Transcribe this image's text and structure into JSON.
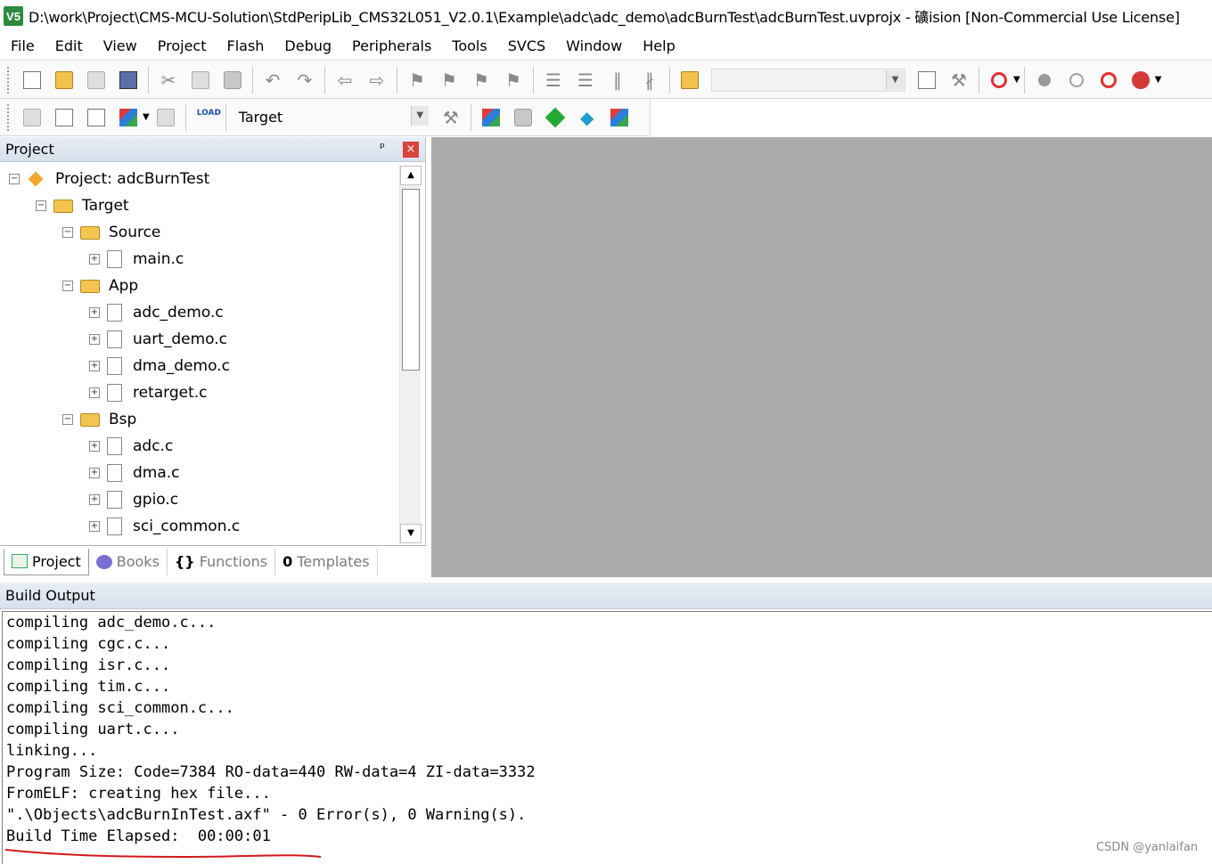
{
  "window": {
    "title": "D:\\work\\Project\\CMS-MCU-Solution\\StdPeripLib_CMS32L051_V2.0.1\\Example\\adc\\adc_demo\\adcBurnTest\\adcBurnTest.uvprojx - 礦ision  [Non-Commercial Use License]",
    "app_icon_label": "V5"
  },
  "menu": [
    "File",
    "Edit",
    "View",
    "Project",
    "Flash",
    "Debug",
    "Peripherals",
    "Tools",
    "SVCS",
    "Window",
    "Help"
  ],
  "toolbar2": {
    "load_label": "LOAD",
    "target_value": "Target"
  },
  "project_panel": {
    "header": "Project",
    "pin_glyph": "ᵖ",
    "close_glyph": "×",
    "tree": {
      "project": "Project: adcBurnTest",
      "target": "Target",
      "groups": [
        {
          "name": "Source",
          "files": [
            "main.c"
          ]
        },
        {
          "name": "App",
          "files": [
            "adc_demo.c",
            "uart_demo.c",
            "dma_demo.c",
            "retarget.c"
          ]
        },
        {
          "name": "Bsp",
          "files": [
            "adc.c",
            "dma.c",
            "gpio.c",
            "sci_common.c"
          ]
        }
      ]
    },
    "tabs": [
      {
        "label": "Project",
        "active": true
      },
      {
        "label": "Books",
        "active": false
      },
      {
        "label": "Functions",
        "active": false
      },
      {
        "label": "Templates",
        "active": false
      }
    ]
  },
  "build_output": {
    "header": "Build Output",
    "lines": [
      "compiling adc_demo.c...",
      "compiling cgc.c...",
      "compiling isr.c...",
      "compiling tim.c...",
      "compiling sci_common.c...",
      "compiling uart.c...",
      "linking...",
      "Program Size: Code=7384 RO-data=440 RW-data=4 ZI-data=3332",
      "FromELF: creating hex file...",
      "\".\\Objects\\adcBurnInTest.axf\" - 0 Error(s), 0 Warning(s).",
      "Build Time Elapsed:  00:00:01"
    ],
    "annotation_color": "#d11a1a"
  },
  "watermark": "CSDN @yanlaifan",
  "colors": {
    "editor_bg": "#ababab",
    "panel_header": "#d8e0ec"
  },
  "icons": {
    "toolbar1": [
      "new-file-icon",
      "open-folder-icon",
      "save-icon",
      "save-all-icon",
      "cut-icon",
      "copy-icon",
      "paste-icon",
      "undo-icon",
      "redo-icon",
      "nav-back-icon",
      "nav-forward-icon",
      "bookmark-icon",
      "prev-bookmark-icon",
      "next-bookmark-icon",
      "clear-bookmarks-icon",
      "indent-icon",
      "unindent-icon",
      "comment-icon",
      "uncomment-icon",
      "find-in-files-icon",
      "find-icon",
      "incremental-find-icon",
      "debug-session-icon",
      "breakpoint-icon",
      "disable-breakpoint-icon",
      "kill-breakpoints-icon",
      "configure-icon"
    ],
    "toolbar2": [
      "translate-icon",
      "build-icon",
      "rebuild-icon",
      "batch-build-icon",
      "stop-build-icon",
      "download-icon",
      "options-icon",
      "manage-components-icon",
      "select-packs-icon",
      "pack-installer-icon",
      "manage-rte-icon",
      "environment-icon"
    ]
  }
}
